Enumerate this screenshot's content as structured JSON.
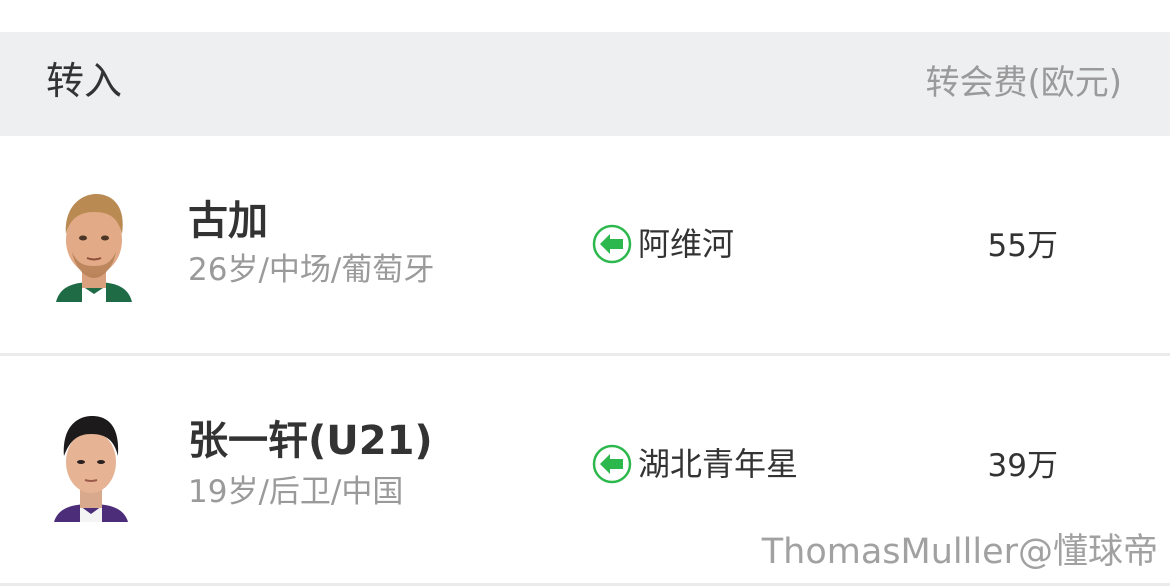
{
  "header": {
    "title": "转入",
    "fee_label": "转会费(欧元)"
  },
  "transfers": [
    {
      "name": "古加",
      "meta": "26岁/中场/葡萄牙",
      "from_club": "阿维河",
      "fee": "55万"
    },
    {
      "name": "张一轩(U21)",
      "meta": "19岁/后卫/中国",
      "from_club": "湖北青年星",
      "fee": "39万"
    }
  ],
  "watermark": "ThomasMulller@懂球帝",
  "colors": {
    "header_bg": "#eeeff1",
    "arrow_green": "#2db84d",
    "muted_text": "#9a9a9a",
    "primary_text": "#333333"
  }
}
